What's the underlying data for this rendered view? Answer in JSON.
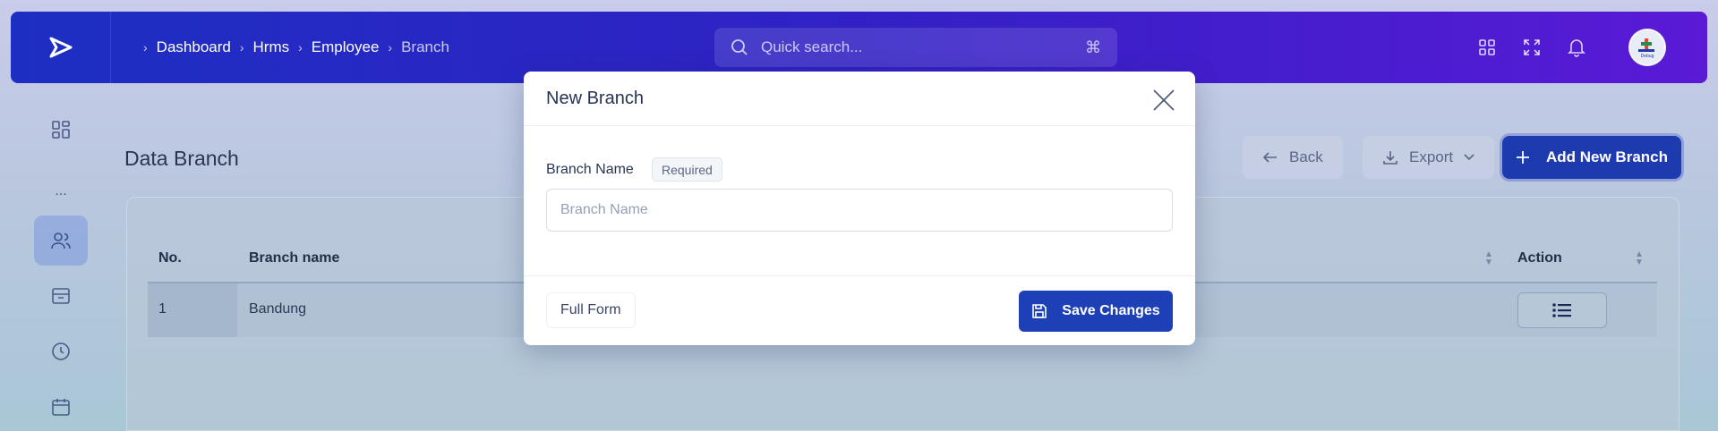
{
  "breadcrumb": [
    "Dashboard",
    "Hrms",
    "Employee",
    "Branch"
  ],
  "search": {
    "placeholder": "Quick search...",
    "shortcut": "⌘"
  },
  "avatar": {
    "text": "Debug"
  },
  "page": {
    "title": "Data Branch",
    "back_label": "Back",
    "export_label": "Export",
    "add_label": "Add New Branch"
  },
  "table": {
    "headers": {
      "no": "No.",
      "name": "Branch name",
      "action": "Action"
    },
    "rows": [
      {
        "no": "1",
        "name": "Bandung"
      }
    ]
  },
  "modal": {
    "title": "New Branch",
    "field_label": "Branch Name",
    "required_badge": "Required",
    "input_placeholder": "Branch Name",
    "full_form_label": "Full Form",
    "save_label": "Save Changes"
  },
  "colors": {
    "primary": "#1d3aaf",
    "topbar_start": "#1d2fc2",
    "topbar_end": "#5a1ad6"
  }
}
